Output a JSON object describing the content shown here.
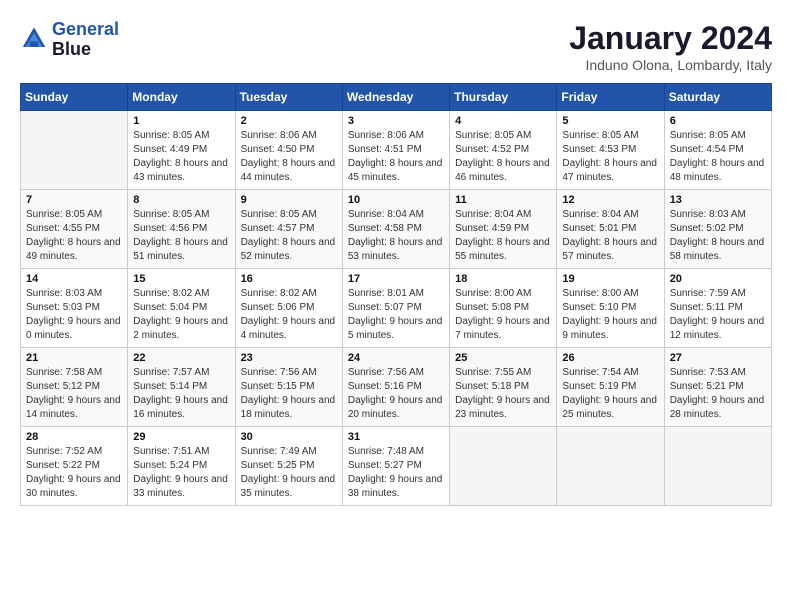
{
  "header": {
    "logo_line1": "General",
    "logo_line2": "Blue",
    "month": "January 2024",
    "location": "Induno Olona, Lombardy, Italy"
  },
  "weekdays": [
    "Sunday",
    "Monday",
    "Tuesday",
    "Wednesday",
    "Thursday",
    "Friday",
    "Saturday"
  ],
  "weeks": [
    [
      {
        "day": "",
        "empty": true
      },
      {
        "day": "1",
        "sunrise": "Sunrise: 8:05 AM",
        "sunset": "Sunset: 4:49 PM",
        "daylight": "Daylight: 8 hours and 43 minutes."
      },
      {
        "day": "2",
        "sunrise": "Sunrise: 8:06 AM",
        "sunset": "Sunset: 4:50 PM",
        "daylight": "Daylight: 8 hours and 44 minutes."
      },
      {
        "day": "3",
        "sunrise": "Sunrise: 8:06 AM",
        "sunset": "Sunset: 4:51 PM",
        "daylight": "Daylight: 8 hours and 45 minutes."
      },
      {
        "day": "4",
        "sunrise": "Sunrise: 8:05 AM",
        "sunset": "Sunset: 4:52 PM",
        "daylight": "Daylight: 8 hours and 46 minutes."
      },
      {
        "day": "5",
        "sunrise": "Sunrise: 8:05 AM",
        "sunset": "Sunset: 4:53 PM",
        "daylight": "Daylight: 8 hours and 47 minutes."
      },
      {
        "day": "6",
        "sunrise": "Sunrise: 8:05 AM",
        "sunset": "Sunset: 4:54 PM",
        "daylight": "Daylight: 8 hours and 48 minutes."
      }
    ],
    [
      {
        "day": "7",
        "sunrise": "Sunrise: 8:05 AM",
        "sunset": "Sunset: 4:55 PM",
        "daylight": "Daylight: 8 hours and 49 minutes."
      },
      {
        "day": "8",
        "sunrise": "Sunrise: 8:05 AM",
        "sunset": "Sunset: 4:56 PM",
        "daylight": "Daylight: 8 hours and 51 minutes."
      },
      {
        "day": "9",
        "sunrise": "Sunrise: 8:05 AM",
        "sunset": "Sunset: 4:57 PM",
        "daylight": "Daylight: 8 hours and 52 minutes."
      },
      {
        "day": "10",
        "sunrise": "Sunrise: 8:04 AM",
        "sunset": "Sunset: 4:58 PM",
        "daylight": "Daylight: 8 hours and 53 minutes."
      },
      {
        "day": "11",
        "sunrise": "Sunrise: 8:04 AM",
        "sunset": "Sunset: 4:59 PM",
        "daylight": "Daylight: 8 hours and 55 minutes."
      },
      {
        "day": "12",
        "sunrise": "Sunrise: 8:04 AM",
        "sunset": "Sunset: 5:01 PM",
        "daylight": "Daylight: 8 hours and 57 minutes."
      },
      {
        "day": "13",
        "sunrise": "Sunrise: 8:03 AM",
        "sunset": "Sunset: 5:02 PM",
        "daylight": "Daylight: 8 hours and 58 minutes."
      }
    ],
    [
      {
        "day": "14",
        "sunrise": "Sunrise: 8:03 AM",
        "sunset": "Sunset: 5:03 PM",
        "daylight": "Daylight: 9 hours and 0 minutes."
      },
      {
        "day": "15",
        "sunrise": "Sunrise: 8:02 AM",
        "sunset": "Sunset: 5:04 PM",
        "daylight": "Daylight: 9 hours and 2 minutes."
      },
      {
        "day": "16",
        "sunrise": "Sunrise: 8:02 AM",
        "sunset": "Sunset: 5:06 PM",
        "daylight": "Daylight: 9 hours and 4 minutes."
      },
      {
        "day": "17",
        "sunrise": "Sunrise: 8:01 AM",
        "sunset": "Sunset: 5:07 PM",
        "daylight": "Daylight: 9 hours and 5 minutes."
      },
      {
        "day": "18",
        "sunrise": "Sunrise: 8:00 AM",
        "sunset": "Sunset: 5:08 PM",
        "daylight": "Daylight: 9 hours and 7 minutes."
      },
      {
        "day": "19",
        "sunrise": "Sunrise: 8:00 AM",
        "sunset": "Sunset: 5:10 PM",
        "daylight": "Daylight: 9 hours and 9 minutes."
      },
      {
        "day": "20",
        "sunrise": "Sunrise: 7:59 AM",
        "sunset": "Sunset: 5:11 PM",
        "daylight": "Daylight: 9 hours and 12 minutes."
      }
    ],
    [
      {
        "day": "21",
        "sunrise": "Sunrise: 7:58 AM",
        "sunset": "Sunset: 5:12 PM",
        "daylight": "Daylight: 9 hours and 14 minutes."
      },
      {
        "day": "22",
        "sunrise": "Sunrise: 7:57 AM",
        "sunset": "Sunset: 5:14 PM",
        "daylight": "Daylight: 9 hours and 16 minutes."
      },
      {
        "day": "23",
        "sunrise": "Sunrise: 7:56 AM",
        "sunset": "Sunset: 5:15 PM",
        "daylight": "Daylight: 9 hours and 18 minutes."
      },
      {
        "day": "24",
        "sunrise": "Sunrise: 7:56 AM",
        "sunset": "Sunset: 5:16 PM",
        "daylight": "Daylight: 9 hours and 20 minutes."
      },
      {
        "day": "25",
        "sunrise": "Sunrise: 7:55 AM",
        "sunset": "Sunset: 5:18 PM",
        "daylight": "Daylight: 9 hours and 23 minutes."
      },
      {
        "day": "26",
        "sunrise": "Sunrise: 7:54 AM",
        "sunset": "Sunset: 5:19 PM",
        "daylight": "Daylight: 9 hours and 25 minutes."
      },
      {
        "day": "27",
        "sunrise": "Sunrise: 7:53 AM",
        "sunset": "Sunset: 5:21 PM",
        "daylight": "Daylight: 9 hours and 28 minutes."
      }
    ],
    [
      {
        "day": "28",
        "sunrise": "Sunrise: 7:52 AM",
        "sunset": "Sunset: 5:22 PM",
        "daylight": "Daylight: 9 hours and 30 minutes."
      },
      {
        "day": "29",
        "sunrise": "Sunrise: 7:51 AM",
        "sunset": "Sunset: 5:24 PM",
        "daylight": "Daylight: 9 hours and 33 minutes."
      },
      {
        "day": "30",
        "sunrise": "Sunrise: 7:49 AM",
        "sunset": "Sunset: 5:25 PM",
        "daylight": "Daylight: 9 hours and 35 minutes."
      },
      {
        "day": "31",
        "sunrise": "Sunrise: 7:48 AM",
        "sunset": "Sunset: 5:27 PM",
        "daylight": "Daylight: 9 hours and 38 minutes."
      },
      {
        "day": "",
        "empty": true
      },
      {
        "day": "",
        "empty": true
      },
      {
        "day": "",
        "empty": true
      }
    ]
  ]
}
